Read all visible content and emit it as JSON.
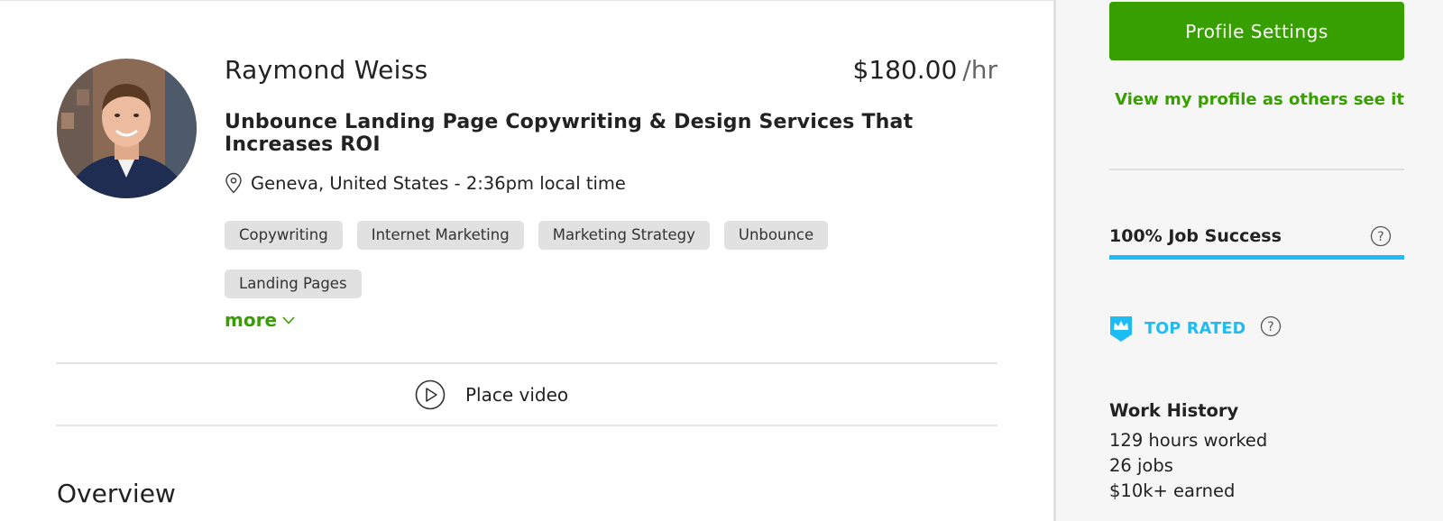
{
  "profile": {
    "name": "Raymond Weiss",
    "rate_amount": "$180.00",
    "rate_unit": "/hr",
    "title": "Unbounce Landing Page Copywriting & Design Services That Increases ROI",
    "location": "Geneva, United States - 2:36pm local time",
    "skills": [
      "Copywriting",
      "Internet Marketing",
      "Marketing Strategy",
      "Unbounce",
      "Landing Pages"
    ],
    "more_label": "more",
    "place_video_label": "Place video",
    "overview_heading": "Overview"
  },
  "sidebar": {
    "settings_button": "Profile Settings",
    "view_profile_link": "View my profile as others see it",
    "job_success_label": "100% Job Success",
    "job_success_value": 100,
    "top_rated_label": "TOP RATED",
    "work_history": {
      "title": "Work History",
      "hours": "129 hours worked",
      "jobs": "26 jobs",
      "earned": "$10k+ earned"
    }
  },
  "icons": {
    "location": "map-pin-icon",
    "more": "chevron-down-icon",
    "video": "play-circle-icon",
    "help": "question-circle-icon",
    "top_rated": "crown-badge-icon"
  },
  "colors": {
    "brand_green": "#37a000",
    "accent_blue": "#1cbdf4",
    "tag_background": "#e1e1e1",
    "sidebar_background": "#f6f6f6"
  }
}
